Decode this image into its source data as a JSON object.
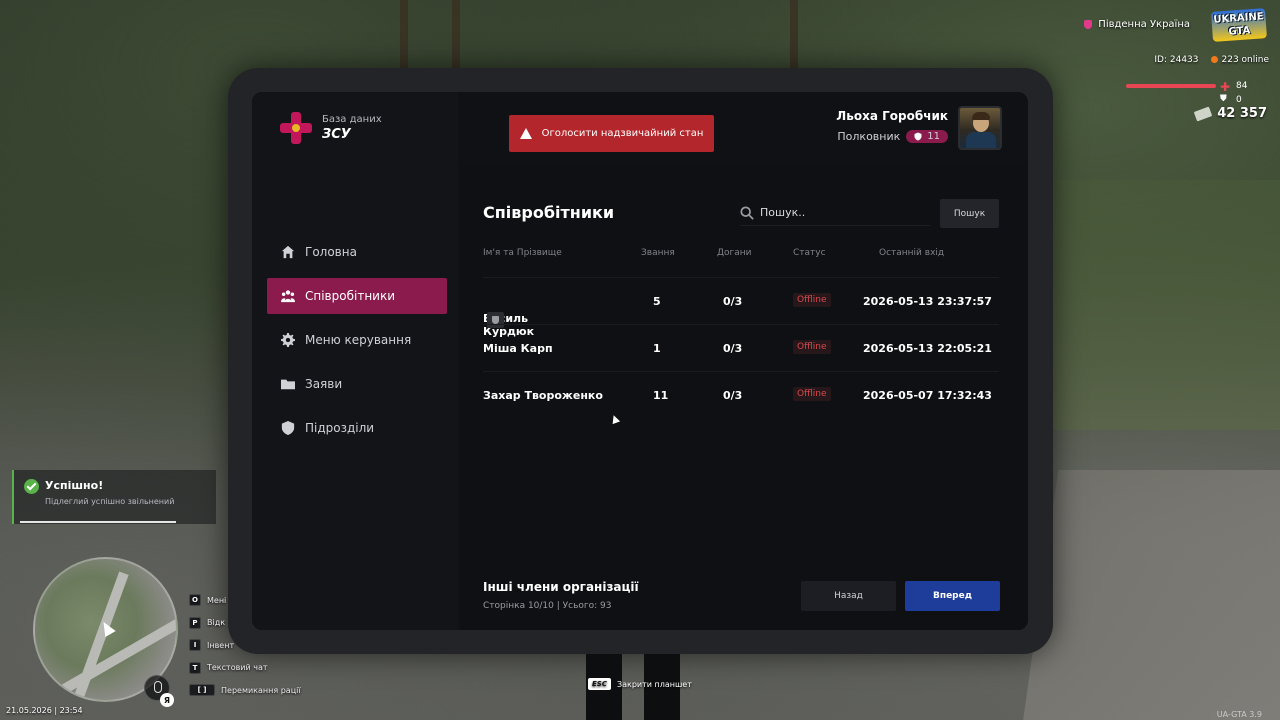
{
  "hud": {
    "region": "Південна Україна",
    "logo_line1": "UKRAINE",
    "logo_line2": "GTA",
    "id_label": "ID: 24433",
    "online": "223 online",
    "health": "84",
    "armor": "0",
    "money": "42 357",
    "health_level": 0.84
  },
  "tablet": {
    "brand_sub": "База даних",
    "brand_main": "ЗСУ",
    "alarm_label": "Оголосити надзвичайний стан",
    "profile": {
      "name": "Льоха Горобчик",
      "rank": "Полковник",
      "rank_badge": "11"
    },
    "nav": [
      {
        "label": "Головна",
        "icon": "home-icon"
      },
      {
        "label": "Співробітники",
        "icon": "people-icon",
        "active": true
      },
      {
        "label": "Меню керування",
        "icon": "gear-icon"
      },
      {
        "label": "Заяви",
        "icon": "folder-icon"
      },
      {
        "label": "Підрозділи",
        "icon": "shield-icon"
      }
    ],
    "page_title": "Співробітники",
    "search_placeholder": "Пошук..",
    "search_button": "Пошук",
    "columns": [
      "Ім'я та Прізвище",
      "Звання",
      "Догани",
      "Статус",
      "Останній вхід"
    ],
    "rows": [
      {
        "name": "Василь Курдюк",
        "rank": "5",
        "reprimands": "0/3",
        "status": "Offline",
        "last_login": "2026-05-13 23:37:57",
        "badge": true
      },
      {
        "name": "Міша Карп",
        "rank": "1",
        "reprimands": "0/3",
        "status": "Offline",
        "last_login": "2026-05-13 22:05:21"
      },
      {
        "name": "Захар Твороженко",
        "rank": "11",
        "reprimands": "0/3",
        "status": "Offline",
        "last_login": "2026-05-07 17:32:43"
      }
    ],
    "footer_title": "Інші члени організації",
    "footer_sub": "Сторінка 10/10 | Усього: 93",
    "back_label": "Назад",
    "next_label": "Вперед",
    "accent": "#8c1b4d",
    "alarm_color": "#b3272c",
    "next_color": "#1e3c9a"
  },
  "notification": {
    "title": "Успішно!",
    "text": "Підлеглий успішно звільнений"
  },
  "keys": [
    {
      "key": "O",
      "label": "Мені"
    },
    {
      "key": "P",
      "label": "Відк"
    },
    {
      "key": "I",
      "label": "Інвент"
    },
    {
      "key": "T",
      "label": "Текстовий чат"
    },
    {
      "key": "[ ]",
      "label": "Перемикання рації"
    }
  ],
  "mic_badge": "Я",
  "datetime": "21.05.2026 | 23:54",
  "esc_key": "ESC",
  "esc_label": "Закрити планшет",
  "version": "UA-GTA 3.9"
}
